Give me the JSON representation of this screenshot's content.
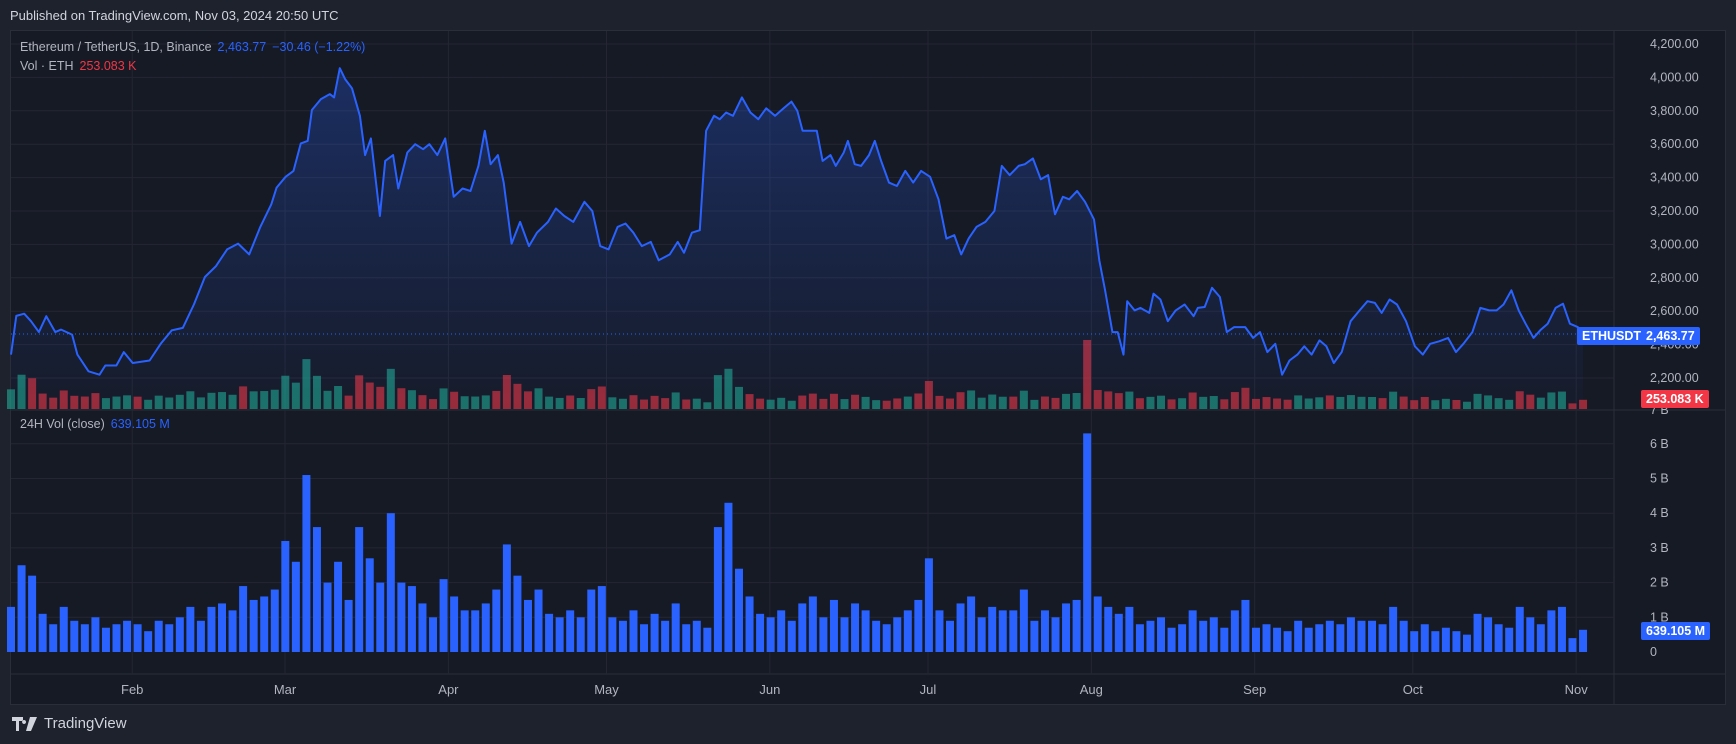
{
  "header": {
    "published": "Published on TradingView.com, Nov 03, 2024 20:50 UTC"
  },
  "legend": {
    "symbol": "Ethereum / TetherUS, 1D, Binance",
    "price": "2,463.77",
    "change": "−30.46 (−1.22%)",
    "vol_label": "Vol · ETH",
    "vol_value": "253.083 K"
  },
  "legend2": {
    "label": "24H Vol (close)",
    "value": "639.105 M"
  },
  "tags": {
    "symbol": "ETHUSDT",
    "price": "2,463.77",
    "vol": "253.083 K",
    "vol24": "639.105 M"
  },
  "footer": {
    "brand": "TradingView"
  },
  "colors": {
    "line": "#2962ff",
    "up": "#22ab94",
    "down": "#f23645",
    "bg": "#161a25",
    "grid": "#242733"
  },
  "chart_data": [
    {
      "type": "line",
      "title": "Ethereum / TetherUS, 1D, Binance",
      "x_unit": "days since Jan 9, 2024",
      "ylim": [
        2000,
        4300
      ],
      "y_ticks": [
        "2,200.00",
        "2,400.00",
        "2,600.00",
        "2,800.00",
        "3,000.00",
        "3,200.00",
        "3,400.00",
        "3,600.00",
        "3,800.00",
        "4,000.00",
        "4,200.00"
      ],
      "x_ticks": [
        {
          "label": "Feb",
          "day": 23
        },
        {
          "label": "Mar",
          "day": 52
        },
        {
          "label": "Apr",
          "day": 83
        },
        {
          "label": "May",
          "day": 113
        },
        {
          "label": "Jun",
          "day": 144
        },
        {
          "label": "Jul",
          "day": 174
        },
        {
          "label": "Aug",
          "day": 205
        },
        {
          "label": "Sep",
          "day": 236
        },
        {
          "label": "Oct",
          "day": 266
        },
        {
          "label": "Nov",
          "day": 297
        }
      ],
      "last_price": 2463.77,
      "points": [
        [
          0,
          2340
        ],
        [
          1,
          2572
        ],
        [
          2.5,
          2585
        ],
        [
          3.8,
          2540
        ],
        [
          5.3,
          2475
        ],
        [
          6.7,
          2570
        ],
        [
          8.4,
          2475
        ],
        [
          9.5,
          2490
        ],
        [
          11.6,
          2460
        ],
        [
          12.6,
          2340
        ],
        [
          14.7,
          2240
        ],
        [
          16.8,
          2220
        ],
        [
          17.9,
          2275
        ],
        [
          20,
          2275
        ],
        [
          21.4,
          2355
        ],
        [
          23.1,
          2290
        ],
        [
          26.3,
          2305
        ],
        [
          28.4,
          2405
        ],
        [
          30.5,
          2485
        ],
        [
          32.6,
          2500
        ],
        [
          34.7,
          2640
        ],
        [
          36.8,
          2805
        ],
        [
          38.9,
          2870
        ],
        [
          41,
          2970
        ],
        [
          43.1,
          3005
        ],
        [
          45.2,
          2940
        ],
        [
          47.3,
          3105
        ],
        [
          49.4,
          3240
        ],
        [
          50.4,
          3340
        ],
        [
          52.1,
          3405
        ],
        [
          53.6,
          3440
        ],
        [
          55,
          3605
        ],
        [
          56.3,
          3620
        ],
        [
          57.1,
          3805
        ],
        [
          58.8,
          3870
        ],
        [
          60.5,
          3900
        ],
        [
          61.3,
          3880
        ],
        [
          62.4,
          4055
        ],
        [
          63.4,
          3990
        ],
        [
          64.7,
          3935
        ],
        [
          66.2,
          3770
        ],
        [
          67.2,
          3535
        ],
        [
          68.3,
          3635
        ],
        [
          70,
          3170
        ],
        [
          71,
          3500
        ],
        [
          72.5,
          3535
        ],
        [
          73.5,
          3335
        ],
        [
          75.2,
          3550
        ],
        [
          76.7,
          3600
        ],
        [
          78.2,
          3570
        ],
        [
          79.4,
          3600
        ],
        [
          80.9,
          3535
        ],
        [
          82.4,
          3635
        ],
        [
          84,
          3285
        ],
        [
          85.7,
          3335
        ],
        [
          87.2,
          3320
        ],
        [
          88.7,
          3470
        ],
        [
          89.9,
          3680
        ],
        [
          91,
          3480
        ],
        [
          92.4,
          3535
        ],
        [
          93.5,
          3370
        ],
        [
          95,
          3005
        ],
        [
          96.6,
          3135
        ],
        [
          98.3,
          2990
        ],
        [
          99.8,
          3070
        ],
        [
          101.9,
          3135
        ],
        [
          103.4,
          3215
        ],
        [
          105,
          3170
        ],
        [
          106.7,
          3135
        ],
        [
          108.8,
          3255
        ],
        [
          110.3,
          3200
        ],
        [
          111.8,
          2990
        ],
        [
          113.4,
          2970
        ],
        [
          115.1,
          3105
        ],
        [
          116.6,
          3125
        ],
        [
          118.1,
          3070
        ],
        [
          119.7,
          2990
        ],
        [
          121.4,
          3015
        ],
        [
          122.9,
          2905
        ],
        [
          125,
          2940
        ],
        [
          126.5,
          3015
        ],
        [
          127.7,
          2950
        ],
        [
          129.2,
          3070
        ],
        [
          130.7,
          3085
        ],
        [
          131.9,
          3680
        ],
        [
          133.4,
          3770
        ],
        [
          134.5,
          3750
        ],
        [
          135.7,
          3790
        ],
        [
          137,
          3770
        ],
        [
          138.7,
          3880
        ],
        [
          140.3,
          3790
        ],
        [
          141.8,
          3750
        ],
        [
          143.3,
          3815
        ],
        [
          145,
          3770
        ],
        [
          146.6,
          3815
        ],
        [
          148.1,
          3855
        ],
        [
          149.2,
          3800
        ],
        [
          150.2,
          3680
        ],
        [
          151.7,
          3680
        ],
        [
          152.9,
          3680
        ],
        [
          154,
          3500
        ],
        [
          155.5,
          3535
        ],
        [
          156.5,
          3470
        ],
        [
          158,
          3550
        ],
        [
          158.8,
          3620
        ],
        [
          160.1,
          3480
        ],
        [
          161.3,
          3470
        ],
        [
          162.8,
          3535
        ],
        [
          163.9,
          3620
        ],
        [
          165.1,
          3500
        ],
        [
          166.6,
          3370
        ],
        [
          168.1,
          3350
        ],
        [
          169.7,
          3440
        ],
        [
          171.2,
          3370
        ],
        [
          172.7,
          3440
        ],
        [
          174.4,
          3405
        ],
        [
          176,
          3270
        ],
        [
          177.5,
          3035
        ],
        [
          179,
          3055
        ],
        [
          180.3,
          2940
        ],
        [
          181.7,
          3035
        ],
        [
          183.2,
          3105
        ],
        [
          184.9,
          3135
        ],
        [
          186.6,
          3200
        ],
        [
          188,
          3470
        ],
        [
          189.5,
          3415
        ],
        [
          191.2,
          3470
        ],
        [
          192.4,
          3480
        ],
        [
          193.9,
          3515
        ],
        [
          195.4,
          3390
        ],
        [
          196.8,
          3415
        ],
        [
          198.1,
          3180
        ],
        [
          199.6,
          3285
        ],
        [
          200.8,
          3270
        ],
        [
          202.3,
          3320
        ],
        [
          203.8,
          3255
        ],
        [
          205.5,
          3150
        ],
        [
          206.5,
          2905
        ],
        [
          207.6,
          2725
        ],
        [
          209,
          2475
        ],
        [
          210,
          2475
        ],
        [
          211.1,
          2340
        ],
        [
          211.8,
          2660
        ],
        [
          213.2,
          2605
        ],
        [
          214.3,
          2620
        ],
        [
          216,
          2590
        ],
        [
          216.8,
          2705
        ],
        [
          218.1,
          2670
        ],
        [
          219.5,
          2540
        ],
        [
          221,
          2605
        ],
        [
          222.7,
          2640
        ],
        [
          224.4,
          2570
        ],
        [
          225.2,
          2620
        ],
        [
          226.5,
          2625
        ],
        [
          227.9,
          2740
        ],
        [
          229.4,
          2685
        ],
        [
          230.7,
          2475
        ],
        [
          232.1,
          2505
        ],
        [
          234.2,
          2505
        ],
        [
          235.7,
          2440
        ],
        [
          237,
          2475
        ],
        [
          238.4,
          2355
        ],
        [
          239.9,
          2405
        ],
        [
          241.2,
          2220
        ],
        [
          242.6,
          2305
        ],
        [
          244.1,
          2340
        ],
        [
          245.4,
          2390
        ],
        [
          246.8,
          2340
        ],
        [
          248.3,
          2425
        ],
        [
          249.6,
          2390
        ],
        [
          251,
          2290
        ],
        [
          252.5,
          2355
        ],
        [
          254.2,
          2540
        ],
        [
          255.9,
          2605
        ],
        [
          257.4,
          2660
        ],
        [
          258.8,
          2650
        ],
        [
          260.1,
          2590
        ],
        [
          261.6,
          2670
        ],
        [
          263,
          2640
        ],
        [
          264.7,
          2540
        ],
        [
          266.4,
          2390
        ],
        [
          267.9,
          2340
        ],
        [
          269.3,
          2405
        ],
        [
          271,
          2420
        ],
        [
          272.7,
          2440
        ],
        [
          274.2,
          2355
        ],
        [
          275.6,
          2405
        ],
        [
          277.3,
          2475
        ],
        [
          278.8,
          2620
        ],
        [
          280.5,
          2605
        ],
        [
          281.9,
          2605
        ],
        [
          283.2,
          2640
        ],
        [
          284.7,
          2725
        ],
        [
          286.1,
          2605
        ],
        [
          287.4,
          2525
        ],
        [
          288.9,
          2440
        ],
        [
          290.3,
          2490
        ],
        [
          291.6,
          2525
        ],
        [
          293.1,
          2620
        ],
        [
          294.5,
          2645
        ],
        [
          295.8,
          2525
        ],
        [
          297.3,
          2505
        ],
        [
          298.3,
          2463.77
        ]
      ]
    },
    {
      "type": "bar",
      "title": "24H Vol (close)",
      "unit": "B (USDT), 2-day buckets",
      "ylim": [
        0,
        7
      ],
      "y_ticks": [
        "0",
        "1 B",
        "2 B",
        "3 B",
        "4 B",
        "5 B",
        "6 B",
        "7 B"
      ],
      "last_value": 0.639105,
      "values": [
        1.3,
        2.5,
        2.2,
        1.1,
        0.8,
        1.3,
        0.9,
        0.8,
        1.0,
        0.7,
        0.8,
        0.9,
        0.8,
        0.6,
        0.9,
        0.8,
        1.0,
        1.3,
        0.9,
        1.3,
        1.4,
        1.2,
        1.9,
        1.5,
        1.6,
        1.8,
        3.2,
        2.6,
        5.1,
        3.6,
        2.0,
        2.6,
        1.5,
        3.6,
        2.7,
        2.0,
        4.0,
        2.0,
        1.9,
        1.4,
        1.0,
        2.1,
        1.6,
        1.2,
        1.2,
        1.4,
        1.8,
        3.1,
        2.2,
        1.5,
        1.8,
        1.1,
        1.0,
        1.2,
        1.0,
        1.8,
        1.9,
        1.0,
        0.9,
        1.2,
        0.8,
        1.1,
        0.9,
        1.4,
        0.8,
        0.9,
        0.7,
        3.6,
        4.3,
        2.4,
        1.6,
        1.1,
        1.0,
        1.2,
        0.9,
        1.4,
        1.6,
        1.0,
        1.5,
        1.0,
        1.4,
        1.2,
        0.9,
        0.8,
        1.0,
        1.2,
        1.5,
        2.7,
        1.2,
        0.9,
        1.4,
        1.6,
        1.0,
        1.3,
        1.2,
        1.2,
        1.8,
        0.9,
        1.2,
        1.0,
        1.4,
        1.5,
        6.3,
        1.6,
        1.3,
        1.1,
        1.3,
        0.8,
        0.9,
        1.0,
        0.7,
        0.8,
        1.2,
        0.9,
        1.0,
        0.7,
        1.2,
        1.5,
        0.7,
        0.8,
        0.7,
        0.6,
        0.9,
        0.7,
        0.8,
        0.9,
        0.8,
        1.0,
        0.9,
        0.9,
        0.8,
        1.3,
        0.9,
        0.6,
        0.8,
        0.6,
        0.7,
        0.6,
        0.5,
        1.1,
        1.0,
        0.8,
        0.7,
        1.3,
        1.0,
        0.8,
        1.2,
        1.3,
        0.4,
        0.64
      ]
    }
  ]
}
